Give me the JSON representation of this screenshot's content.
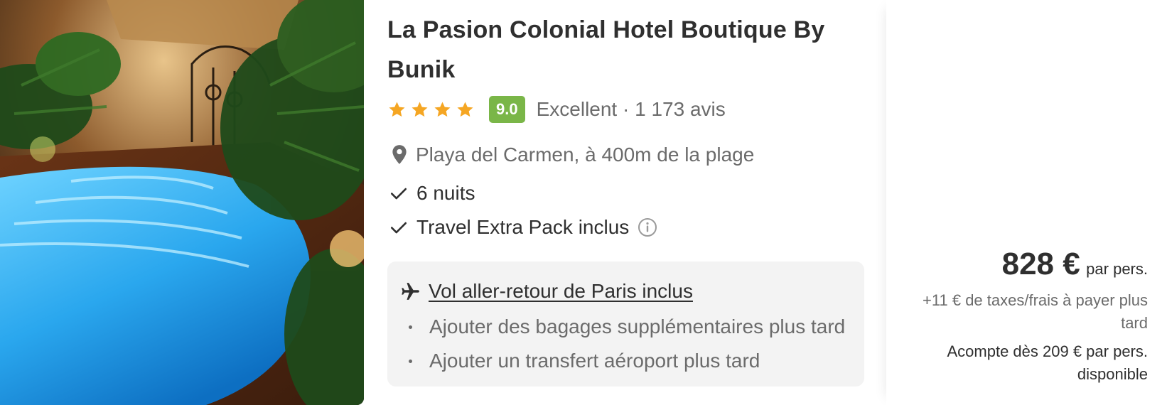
{
  "hotel": {
    "name": "La Pasion Colonial Hotel Boutique By Bunik",
    "stars": 4,
    "score": "9.0",
    "rating_summary": "Excellent · 1 173 avis",
    "location": "Playa del Carmen, à 400m de la plage"
  },
  "features": [
    {
      "label": "6 nuits",
      "icon": "check-icon",
      "has_info": false
    },
    {
      "label": "Travel Extra Pack inclus",
      "icon": "check-icon",
      "has_info": true
    }
  ],
  "flight": {
    "link_label": "Vol aller-retour de Paris inclus",
    "extras": [
      "Ajouter des bagages supplémentaires plus tard",
      "Ajouter un transfert aéroport plus tard"
    ]
  },
  "price": {
    "amount": "828 €",
    "per_person": "par pers.",
    "taxes_note": "+11 € de taxes/frais à payer plus tard",
    "deposit_note": "Acompte dès 209 € par pers. disponible"
  },
  "colors": {
    "score_badge": "#7ab648",
    "star": "#f5a623",
    "text_primary": "#2f2f2f",
    "text_secondary": "#6b6b6b",
    "box_bg": "#f3f3f3"
  },
  "icons": {
    "location": "map-pin-icon",
    "check": "check-icon",
    "info": "info-icon",
    "plane": "plane-icon",
    "star": "star-icon"
  }
}
